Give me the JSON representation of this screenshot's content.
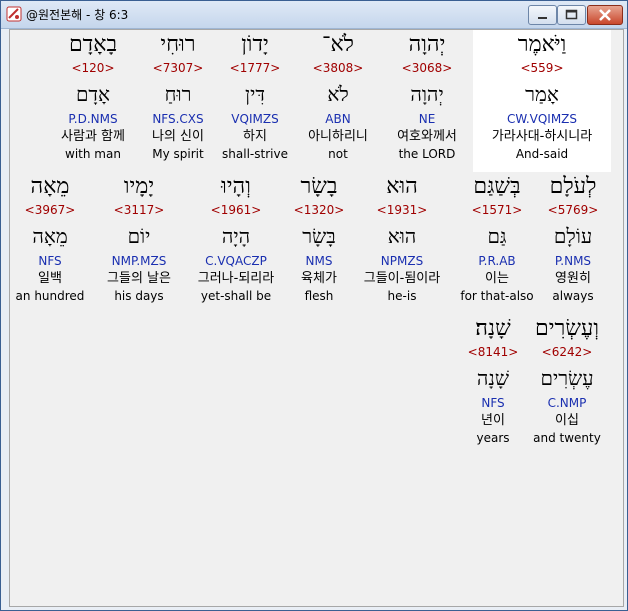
{
  "window": {
    "title": "@원전본해 - 창 6:3"
  },
  "rows": [
    [
      {
        "hebrew": "וַיֹּאמֶר",
        "strong": "<559>",
        "lemma": "אָמַר",
        "morph": "CW.VQIMZS",
        "korean": "가라사대-하시니라",
        "english": "And-said",
        "highlight": true
      },
      {
        "hebrew": "יְהוָה",
        "strong": "<3068>",
        "lemma": "יְהוָה",
        "morph": "NE",
        "korean": "여호와께서",
        "english": "the LORD"
      },
      {
        "hebrew": "לֹא־",
        "strong": "<3808>",
        "lemma": "לֹא",
        "morph": "ABN",
        "korean": "아니하리니",
        "english": "not"
      },
      {
        "hebrew": "יָדוֹן",
        "strong": "<1777>",
        "lemma": "דִּין",
        "morph": "VQIMZS",
        "korean": "하지",
        "english": "shall-strive"
      },
      {
        "hebrew": "רוּחִי",
        "strong": "<7307>",
        "lemma": "רוּחַ",
        "morph": "NFS.CXS",
        "korean": "나의 신이",
        "english": "My spirit"
      },
      {
        "hebrew": "בָאָדָם",
        "strong": "<120>",
        "lemma": "אָדָם",
        "morph": "P.D.NMS",
        "korean": "사람과 함께",
        "english": "with man"
      }
    ],
    [
      {
        "hebrew": "לְעֹלָם",
        "strong": "<5769>",
        "lemma": "עוֹלָם",
        "morph": "P.NMS",
        "korean": "영원히",
        "english": "always"
      },
      {
        "hebrew": "בְּשַׁגַּם",
        "strong": "<1571>",
        "lemma": "גַּם",
        "morph": "P.R.AB",
        "korean": "이는",
        "english": "for that-also"
      },
      {
        "hebrew": "הוּא",
        "strong": "<1931>",
        "lemma": "הוּא",
        "morph": "NPMZS",
        "korean": "그들이-됨이라",
        "english": "he-is"
      },
      {
        "hebrew": "בָשָׂר",
        "strong": "<1320>",
        "lemma": "בָּשָׂר",
        "morph": "NMS",
        "korean": "육체가",
        "english": "flesh"
      },
      {
        "hebrew": "וְהָיוּ",
        "strong": "<1961>",
        "lemma": "הָיָה",
        "morph": "C.VQACZP",
        "korean": "그러나-되리라",
        "english": "yet-shall be"
      },
      {
        "hebrew": "יָמָיו",
        "strong": "<3117>",
        "lemma": "יוֹם",
        "morph": "NMP.MZS",
        "korean": "그들의 날은",
        "english": "his days"
      },
      {
        "hebrew": "מֵאָה",
        "strong": "<3967>",
        "lemma": "מֵאָה",
        "morph": "NFS",
        "korean": "일백",
        "english": "an hundred"
      }
    ],
    [
      {
        "hebrew": "וְעֶשְׂרִים",
        "strong": "<6242>",
        "lemma": "עֶשְׂרִים",
        "morph": "C.NMP",
        "korean": "이십",
        "english": "and twenty"
      },
      {
        "hebrew": "שָׁנָה׃",
        "strong": "<8141>",
        "lemma": "שָׁנָה",
        "morph": "NFS",
        "korean": "년이",
        "english": "years"
      }
    ]
  ]
}
